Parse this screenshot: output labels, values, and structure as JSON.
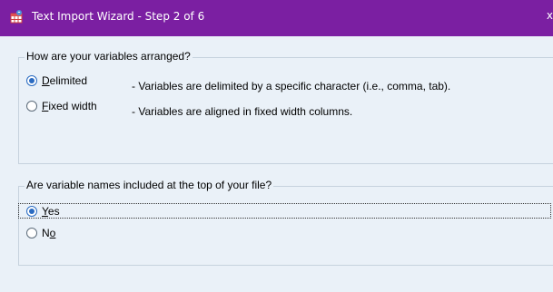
{
  "window": {
    "title": "Text Import Wizard - Step 2 of 6",
    "close_glyph": "x",
    "app_icon": "spreadsheet-wizard-icon",
    "titlebar_color": "#7b1fa2"
  },
  "arrangement": {
    "legend": "How are your variables arranged?",
    "options": [
      {
        "label_pre": "",
        "label_access": "D",
        "label_post": "elimited",
        "description": "- Variables are delimited by a specific character (i.e., comma, tab).",
        "selected": true
      },
      {
        "label_pre": "",
        "label_access": "F",
        "label_post": "ixed width",
        "description": "- Variables are aligned in fixed width columns.",
        "selected": false
      }
    ]
  },
  "names": {
    "legend": "Are variable names included at the top of your file?",
    "options": [
      {
        "label_pre": "",
        "label_access": "Y",
        "label_post": "es",
        "selected": true
      },
      {
        "label_pre": "N",
        "label_access": "o",
        "label_post": "",
        "selected": false
      }
    ]
  }
}
